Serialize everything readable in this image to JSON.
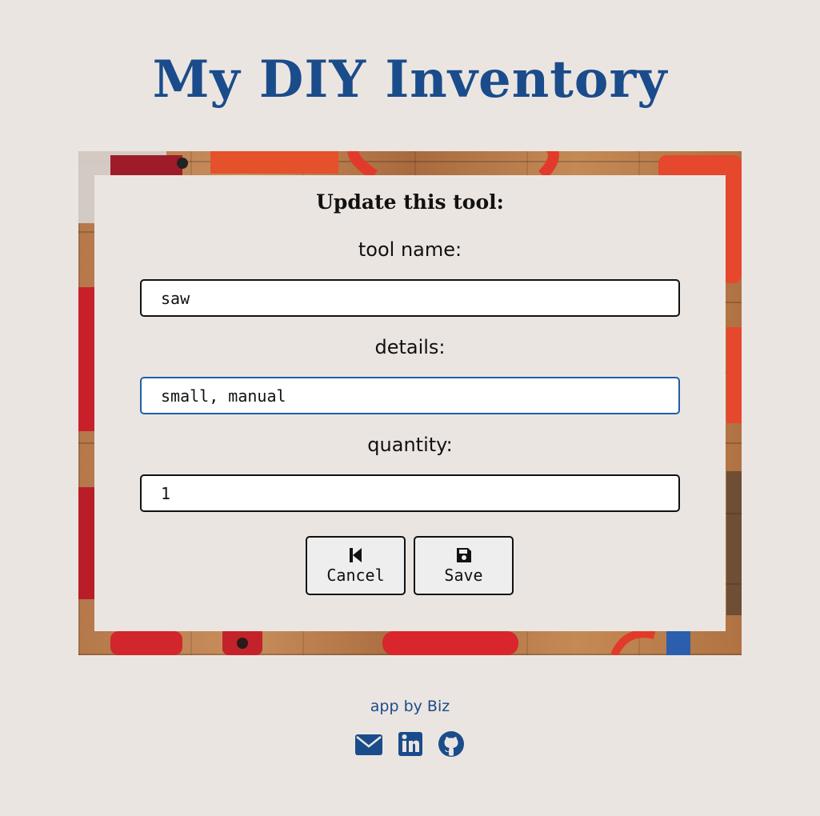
{
  "header": {
    "title": "My DIY Inventory"
  },
  "form": {
    "heading": "Update this tool:",
    "fields": [
      {
        "label": "tool name:",
        "value": "saw"
      },
      {
        "label": "details:",
        "value": "small, manual"
      },
      {
        "label": "quantity:",
        "value": "1"
      }
    ],
    "buttons": {
      "cancel": "Cancel",
      "save": "Save"
    }
  },
  "footer": {
    "credit": "app by Biz",
    "links": [
      "envelope-icon",
      "linkedin-icon",
      "github-icon"
    ]
  },
  "colors": {
    "brand": "#1a4c8b",
    "background": "#ebe5e1",
    "focus": "#1f5fa8"
  }
}
